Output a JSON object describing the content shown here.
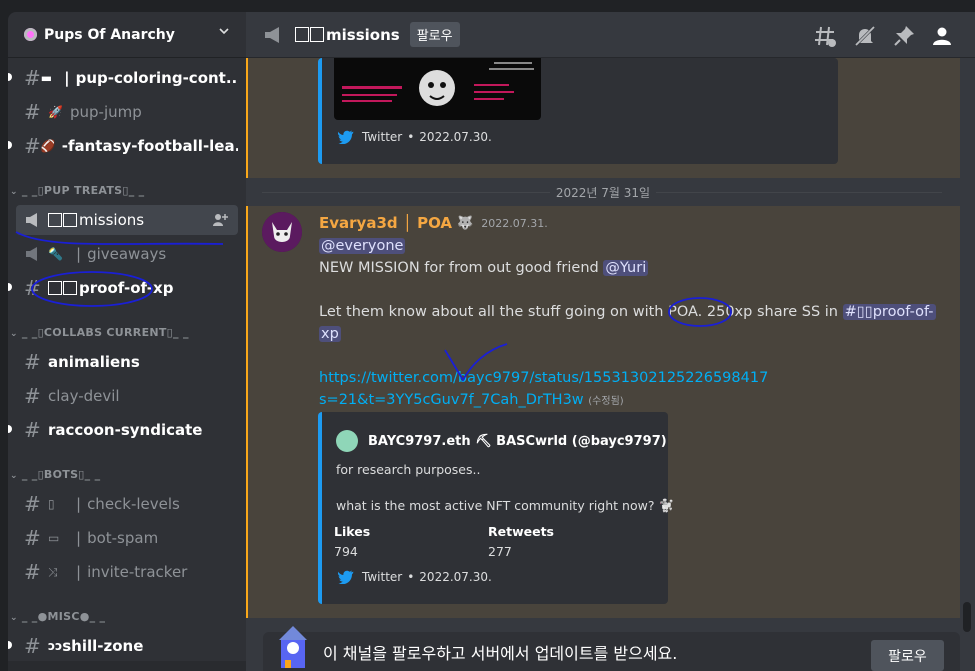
{
  "server": {
    "name": "Pups Of Anarchy"
  },
  "channels": {
    "coloring": {
      "emoji": "▬",
      "label": "pup-coloring-cont..."
    },
    "jump": {
      "emoji": "🚀",
      "label": "pup-jump"
    },
    "football": {
      "emoji": "🏈",
      "label": "-fantasy-football-lea..."
    },
    "missions": {
      "label": "missions"
    },
    "giveaways": {
      "emoji": "🔦",
      "label": "giveaways"
    },
    "proof": {
      "label": "proof-of-xp"
    },
    "animaliens": {
      "label": "animaliens"
    },
    "clay": {
      "label": "clay-devil"
    },
    "raccoon": {
      "label": "raccoon-syndicate"
    },
    "levels": {
      "emoji": "▯",
      "label": "check-levels"
    },
    "botspam": {
      "emoji": "▭",
      "label": "bot-spam"
    },
    "invite": {
      "emoji": "⤨",
      "label": "invite-tracker"
    },
    "shill": {
      "emoji": "ᴐᴐ",
      "label": "shill-zone"
    }
  },
  "categories": {
    "treats": "_ _▯PUP TREATS▯_ _",
    "collabs": "_ _▯COLLABS CURRENT▯_ _",
    "bots": "_ _▯BOTS▯_ _",
    "misc": "_ _●MISC●_ _"
  },
  "topbar": {
    "title": "missions",
    "follow_label": "팔로우"
  },
  "embed_top": {
    "footer_source": "Twitter",
    "footer_date": "2022.07.30."
  },
  "date_divider": "2022년 7월 31일",
  "message": {
    "author": "Evarya3d │ POA",
    "role_icon": "🐺",
    "timestamp": "2022.07.31.",
    "mention_everyone": "@everyone",
    "line1": "NEW MISSION for from out good friend ",
    "mention_yuri": "@Yuri",
    "line2a": "Let them know about all the stuff going on with POA. ",
    "line2_xp": "250xp",
    "line2b": " share SS in ",
    "channel_mention": "#▯▯proof-of-",
    "channel_mention_cont": "xp",
    "link_line1": "https://twitter.com/bayc9797/status/15531302125226598417",
    "link_line2": "s=21&t=3YY5cGuv7f_7Cah_DrTH3w",
    "edited": "(수정됨)"
  },
  "tweet": {
    "author": "BAYC9797.eth ⛏ BASCwrld (@bayc9797)",
    "line1": "for research purposes..",
    "line2": "what is the most active NFT community right now? 🐩",
    "likes_label": "Likes",
    "likes_value": "794",
    "retweets_label": "Retweets",
    "retweets_value": "277",
    "footer_source": "Twitter",
    "footer_date": "2022.07.30."
  },
  "follow_bar": {
    "message": "이 채널을 팔로우하고 서버에서 업데이트를 받으세요.",
    "button": "팔로우"
  },
  "colors": {
    "accent_mention": "#5865f2",
    "link": "#00aff4",
    "author": "#f5a742",
    "twitter": "#1d9bf1"
  }
}
